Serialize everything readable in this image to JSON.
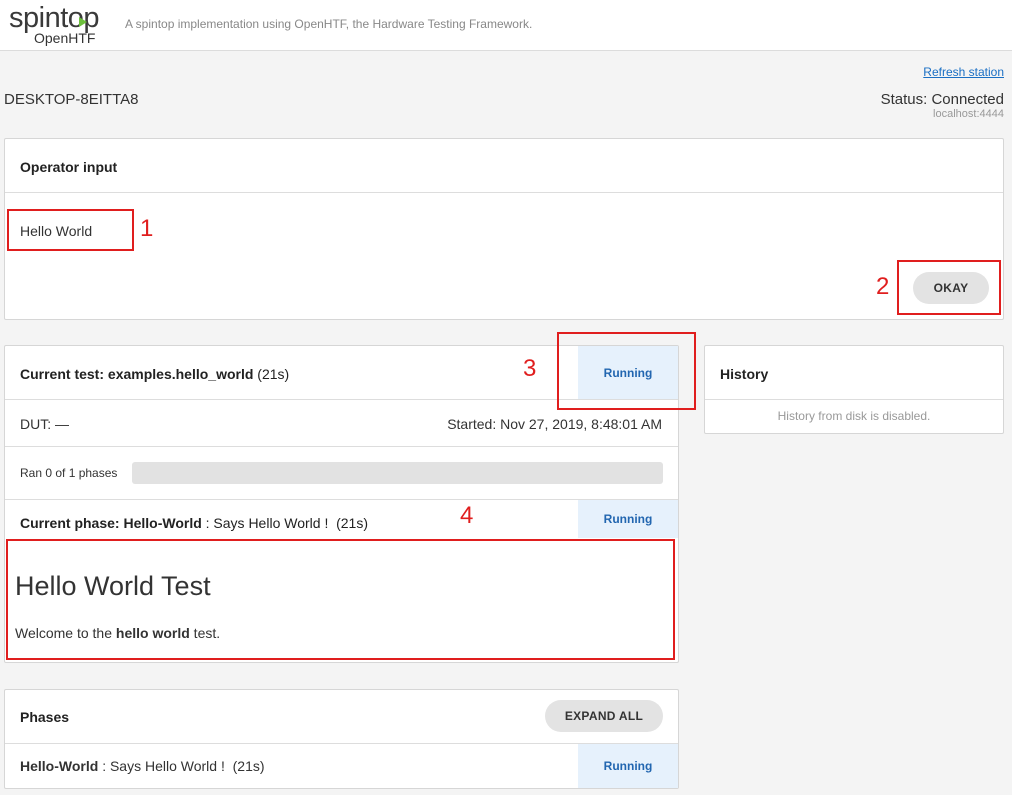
{
  "header": {
    "logo_text": "spintop",
    "logo_sub": "OpenHTF",
    "tagline": "A spintop implementation using OpenHTF, the Hardware Testing Framework."
  },
  "station": {
    "name": "DESKTOP-8EITTA8",
    "refresh_label": "Refresh station",
    "status": "Status: Connected",
    "host": "localhost:4444"
  },
  "operator_input": {
    "title": "Operator input",
    "value": "Hello World",
    "okay_label": "OKAY"
  },
  "current_test": {
    "title_prefix": "Current test:",
    "test_name": "examples.hello_world",
    "elapsed": "(21s)",
    "status": "Running",
    "dut": "DUT: —",
    "started": "Started: Nov 27, 2019, 8:48:01 AM",
    "progress_label": "Ran 0 of 1 phases",
    "progress": 0.0
  },
  "current_phase": {
    "title_prefix": "Current phase:",
    "phase_name": "Hello-World",
    "description": ": Says Hello World !",
    "elapsed": "(21s)",
    "status": "Running",
    "heading": "Hello World Test",
    "body_before": "Welcome to the ",
    "body_bold": "hello world",
    "body_after": " test."
  },
  "history": {
    "title": "History",
    "message": "History from disk is disabled."
  },
  "phases": {
    "title": "Phases",
    "expand_label": "EXPAND ALL",
    "items": [
      {
        "name": "Hello-World",
        "description": ": Says Hello World !",
        "elapsed": "(21s)",
        "status": "Running"
      }
    ]
  },
  "annotations": {
    "n1": "1",
    "n2": "2",
    "n3": "3",
    "n4": "4"
  },
  "colors": {
    "accent_green": "#6cbf3b",
    "link_blue": "#1a6fc4",
    "running_bg": "#e6f1fc",
    "running_text": "#2266b0",
    "annotation_red": "#e01e1e"
  }
}
